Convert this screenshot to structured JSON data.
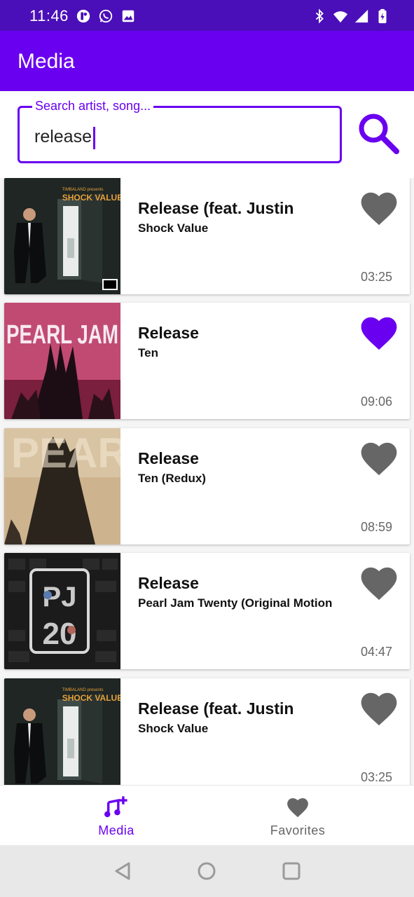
{
  "status_bar": {
    "time": "11:46",
    "left_icons": [
      "app-notification-icon",
      "whatsapp-icon",
      "image-icon"
    ],
    "right_icons": [
      "bluetooth-icon",
      "wifi-icon",
      "signal-icon",
      "battery-icon"
    ]
  },
  "app_bar": {
    "title": "Media"
  },
  "search": {
    "label": "Search artist, song...",
    "value": "release",
    "button_icon": "search-icon"
  },
  "songs": [
    {
      "title": "Release (feat. Justin",
      "album": "Shock Value",
      "duration": "03:25",
      "favorite": false,
      "cover": "shock-value-cover"
    },
    {
      "title": "Release",
      "album": "Ten",
      "duration": "09:06",
      "favorite": true,
      "cover": "pearl-jam-ten-cover"
    },
    {
      "title": "Release",
      "album": "Ten (Redux)",
      "duration": "08:59",
      "favorite": false,
      "cover": "pearl-jam-ten-redux-cover"
    },
    {
      "title": "Release",
      "album": "Pearl Jam Twenty (Original Motion",
      "duration": "04:47",
      "favorite": false,
      "cover": "pearl-jam-twenty-cover"
    },
    {
      "title": "Release (feat. Justin",
      "album": "Shock Value",
      "duration": "03:25",
      "favorite": false,
      "cover": "shock-value-cover"
    }
  ],
  "bottom_nav": {
    "items": [
      {
        "label": "Media",
        "icon": "music-note-add-icon",
        "active": true
      },
      {
        "label": "Favorites",
        "icon": "heart-icon",
        "active": false
      }
    ]
  },
  "system_nav": [
    "back-icon",
    "home-icon",
    "recents-icon"
  ],
  "colors": {
    "primary": "#6a00f0",
    "status_bar": "#4a0fb8",
    "favorite_active": "#6a00f0",
    "favorite_inactive": "#666666",
    "nav_inactive": "#666666"
  }
}
